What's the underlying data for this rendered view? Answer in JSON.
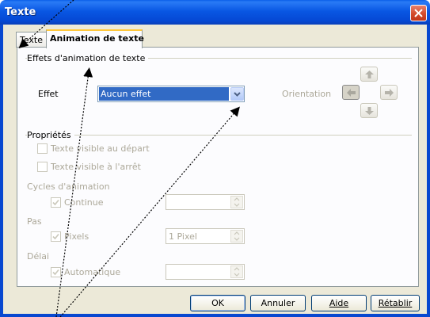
{
  "window": {
    "title": "Texte"
  },
  "tabs": [
    {
      "label": "Texte",
      "active": false
    },
    {
      "label": "Animation de texte",
      "active": true
    }
  ],
  "effects_section": {
    "title": "Effets d'animation de texte",
    "effect_label": "Effet",
    "effect_value": "Aucun effet",
    "orientation_label": "Orientation",
    "orientation_buttons": [
      "arrow-up-icon",
      "arrow-left-icon",
      "arrow-right-icon",
      "arrow-down-icon"
    ]
  },
  "properties_section": {
    "title": "Propriétés",
    "checkbox_visible_start": "Texte visible au départ",
    "checkbox_visible_stop": "Texte visible à l'arrêt",
    "cycles_label": "Cycles d'animation",
    "cycles_continue": "Continue",
    "cycles_value": "",
    "step_label": "Pas",
    "step_pixels": "Pixels",
    "step_value": "1 Pixel",
    "delay_label": "Délai",
    "delay_auto": "Automatique",
    "delay_value": ""
  },
  "buttons": {
    "ok": "OK",
    "cancel": "Annuler",
    "help": "Aide",
    "reset": "Rétablir"
  },
  "colors": {
    "titlebar": "#0957e3",
    "selection": "#316ac5",
    "tab_highlight": "#ffc83c",
    "disabled_text": "#aca899"
  }
}
